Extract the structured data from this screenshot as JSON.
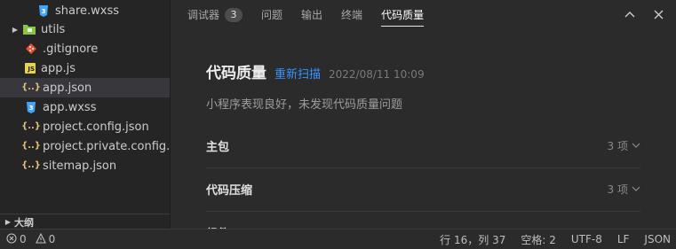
{
  "sidebar": {
    "files": [
      {
        "label": "share.wxss",
        "icon": "css-icon"
      },
      {
        "label": "utils",
        "icon": "folder-icon"
      },
      {
        "label": ".gitignore",
        "icon": "git-icon"
      },
      {
        "label": "app.js",
        "icon": "js-icon"
      },
      {
        "label": "app.json",
        "icon": "json-icon",
        "selected": true
      },
      {
        "label": "app.wxss",
        "icon": "css-icon"
      },
      {
        "label": "project.config.json",
        "icon": "json-icon"
      },
      {
        "label": "project.private.config.js...",
        "icon": "json-icon"
      },
      {
        "label": "sitemap.json",
        "icon": "json-icon"
      }
    ],
    "outline_label": "大纲"
  },
  "panel": {
    "tabs": [
      {
        "label": "调试器",
        "badge": "3"
      },
      {
        "label": "问题"
      },
      {
        "label": "输出"
      },
      {
        "label": "终端"
      },
      {
        "label": "代码质量",
        "active": true
      }
    ],
    "title": "代码质量",
    "rescan_label": "重新扫描",
    "timestamp": "2022/08/11 10:09",
    "summary": "小程序表现良好，未发现代码质量问题",
    "sections": [
      {
        "title": "主包",
        "count": "3 项"
      },
      {
        "title": "代码压缩",
        "count": "3 项"
      },
      {
        "title": "组件",
        "count": ""
      }
    ]
  },
  "statusbar": {
    "errors": "0",
    "warnings": "0",
    "position": "行 16，列 37",
    "indent": "空格: 2",
    "encoding": "UTF-8",
    "eol": "LF",
    "language": "JSON"
  },
  "colors": {
    "accent_link": "#3794ff",
    "background": "#2b2b2b",
    "sidebar_bg": "#252526",
    "selected_row": "#37373d"
  }
}
